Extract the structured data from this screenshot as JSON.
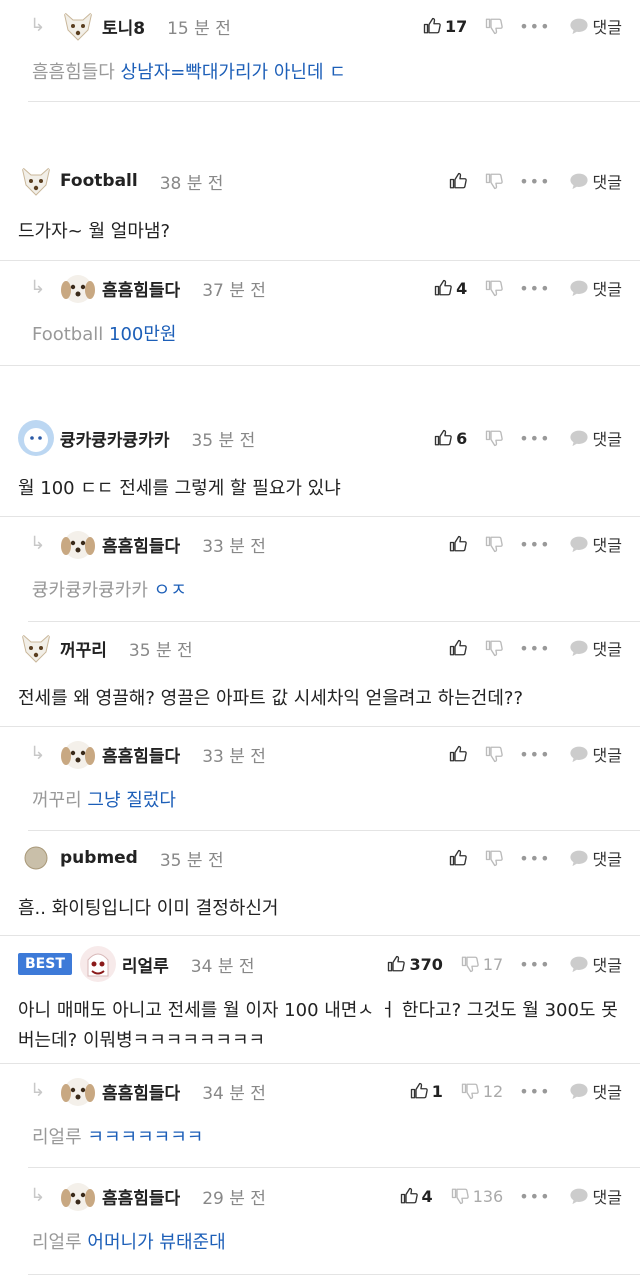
{
  "ui": {
    "time_unit": "분 전",
    "reply_label": "댓글",
    "best_label": "BEST",
    "more_glyph": "•••"
  },
  "comments": [
    {
      "nick": "토니8",
      "time": "15 분 전",
      "like": "17",
      "dislike": "",
      "mention": "흠흠힘들다",
      "text": "상남자=빡대가리가 아닌데 ㄷ",
      "reply": true,
      "best": false
    },
    {
      "nick": "Football",
      "time": "38 분 전",
      "like": "",
      "dislike": "",
      "mention": "",
      "text": "드가자~ 월 얼마냄?",
      "reply": false,
      "best": false
    },
    {
      "nick": "흠흠힘들다",
      "time": "37 분 전",
      "like": "4",
      "dislike": "",
      "mention": "Football",
      "text": "100만원",
      "reply": true,
      "best": false
    },
    {
      "nick": "큥카큥카큥카카",
      "time": "35 분 전",
      "like": "6",
      "dislike": "",
      "mention": "",
      "text": "월 100 ㄷㄷ 전세를 그렇게 할 필요가 있냐",
      "reply": false,
      "best": false
    },
    {
      "nick": "흠흠힘들다",
      "time": "33 분 전",
      "like": "",
      "dislike": "",
      "mention": "큥카큥카큥카카",
      "text": "ㅇㅈ",
      "reply": true,
      "best": false
    },
    {
      "nick": "꺼꾸리",
      "time": "35 분 전",
      "like": "",
      "dislike": "",
      "mention": "",
      "text": "전세를 왜 영끌해? 영끌은 아파트 값 시세차익 얻을려고 하는건데??",
      "reply": false,
      "best": false
    },
    {
      "nick": "흠흠힘들다",
      "time": "33 분 전",
      "like": "",
      "dislike": "",
      "mention": "꺼꾸리",
      "text": "그냥 질렀다",
      "reply": true,
      "best": false
    },
    {
      "nick": "pubmed",
      "time": "35 분 전",
      "like": "",
      "dislike": "",
      "mention": "",
      "text": "흠.. 화이팅입니다 이미 결정하신거",
      "reply": false,
      "best": false
    },
    {
      "nick": "리얼루",
      "time": "34 분 전",
      "like": "370",
      "dislike": "17",
      "mention": "",
      "text": "아니 매매도 아니고 전세를 월 이자 100 내면ㅅ ㅓ 한다고? 그것도 월 300도 못버는데? 이뭐병ㅋㅋㅋㅋㅋㅋㅋㅋ",
      "reply": false,
      "best": true
    },
    {
      "nick": "흠흠힘들다",
      "time": "34 분 전",
      "like": "1",
      "dislike": "12",
      "mention": "리얼루",
      "text": "ㅋㅋㅋㅋㅋㅋㅋ",
      "reply": true,
      "best": false
    },
    {
      "nick": "흠흠힘들다",
      "time": "29 분 전",
      "like": "4",
      "dislike": "136",
      "mention": "리얼루",
      "text": "어머니가 뷰태준대",
      "reply": true,
      "best": false
    }
  ],
  "icons": {
    "like": "thumb-up-icon",
    "dislike": "thumb-down-icon",
    "reply_arrow": "reply-arrow-icon",
    "more": "more-dots-icon",
    "comment": "speech-bubble-icon"
  },
  "colors": {
    "accent": "#1d5fb8",
    "best_badge": "#3d7ad8",
    "divider": "#e4e4e4"
  }
}
